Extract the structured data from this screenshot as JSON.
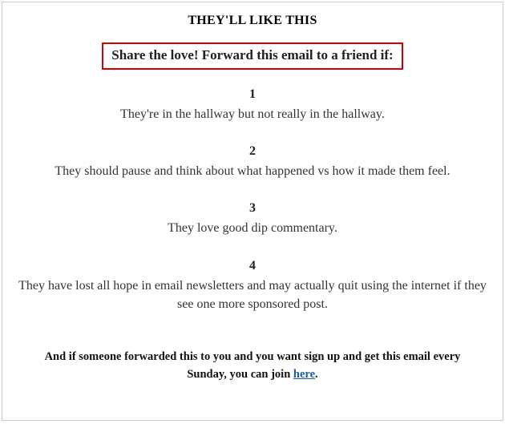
{
  "heading": "THEY'LL LIKE THIS",
  "subheading": "Share the love! Forward this email to a friend if:",
  "items": [
    {
      "num": "1",
      "text": "They're in the hallway but not really in the hallway."
    },
    {
      "num": "2",
      "text": "They should pause and think about what happened vs how it made them feel."
    },
    {
      "num": "3",
      "text": "They love good dip commentary."
    },
    {
      "num": "4",
      "text": "They have lost all hope in email newsletters and may actually quit using the internet if they see one more sponsored post."
    }
  ],
  "footer": {
    "prefix": "And if someone forwarded this to you and you want sign up and get this email every Sunday, you can join ",
    "link_text": "here",
    "suffix": "."
  }
}
